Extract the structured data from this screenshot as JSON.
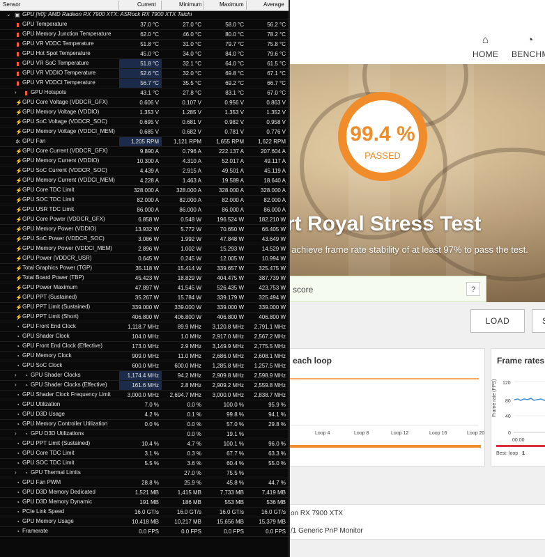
{
  "app": {
    "nav": {
      "home": "HOME",
      "benchmarks": "BENCHM"
    },
    "score": {
      "value": "99.4 %",
      "status": "PASSED"
    },
    "test_title": "rt Royal Stress Test",
    "test_subtitle": "t achieve frame rate stability of at least 97% to pass the test.",
    "score_box_label": "score",
    "help_label": "?",
    "load_label": "LOAD",
    "save_label": "S",
    "loop_panel_title": "each loop",
    "fps_panel_title": "Frame rates f",
    "loop_ticks": [
      "Loop 4",
      "Loop 8",
      "Loop 12",
      "Loop 16",
      "Loop 20"
    ],
    "fps_axis_label": "Frame rate (FPS)",
    "fps_ticks": [
      "120",
      "80",
      "40",
      "0"
    ],
    "fps_time_ticks": [
      "00:00",
      "00"
    ],
    "best_loop_label": "Best: loop",
    "best_loop_value": "1",
    "info_gpu": "on RX 7900 XTX",
    "info_monitor": "/1 Generic PnP Monitor",
    "colors": {
      "accent": "#f08d2a",
      "fps_line": "#3a8fd6"
    }
  },
  "hwinfo": {
    "columns": [
      "Sensor",
      "Current",
      "Minimum",
      "Maximum",
      "Average"
    ],
    "group_title": "GPU [#0]: AMD Radeon RX 7900 XTX: ASRock RX 7900 XTX Taichi",
    "rows": [
      {
        "icon": "temp",
        "name": "GPU Temperature",
        "cur": "37.0 °C",
        "min": "27.0 °C",
        "max": "58.0 °C",
        "avg": "56.2 °C"
      },
      {
        "icon": "temp",
        "name": "GPU Memory Junction Temperature",
        "cur": "62.0 °C",
        "min": "46.0 °C",
        "max": "80.0 °C",
        "avg": "78.2 °C"
      },
      {
        "icon": "temp",
        "name": "GPU VR VDDC Temperature",
        "cur": "51.8 °C",
        "min": "31.0 °C",
        "max": "79.7 °C",
        "avg": "75.8 °C"
      },
      {
        "icon": "temp",
        "name": "GPU Hot Spot Temperature",
        "cur": "45.0 °C",
        "min": "34.0 °C",
        "max": "84.0 °C",
        "avg": "79.6 °C"
      },
      {
        "icon": "temp",
        "name": "GPU VR SoC Temperature",
        "cur": "51.8 °C",
        "min": "32.1 °C",
        "max": "64.0 °C",
        "avg": "61.5 °C",
        "hl": true
      },
      {
        "icon": "temp",
        "name": "GPU VR VDDIO Temperature",
        "cur": "52.6 °C",
        "min": "32.0 °C",
        "max": "69.8 °C",
        "avg": "67.1 °C",
        "hl": true
      },
      {
        "icon": "temp",
        "name": "GPU VR VDDCI Temperature",
        "cur": "56.7 °C",
        "min": "35.5 °C",
        "max": "69.2 °C",
        "avg": "66.7 °C",
        "hl": true
      },
      {
        "icon": "temp",
        "name": "GPU Hotspots",
        "cur": "43.1 °C",
        "min": "27.8 °C",
        "max": "83.1 °C",
        "avg": "67.0 °C",
        "expand": true
      },
      {
        "icon": "volt",
        "name": "GPU Core Voltage (VDDCR_GFX)",
        "cur": "0.606 V",
        "min": "0.107 V",
        "max": "0.956 V",
        "avg": "0.863 V"
      },
      {
        "icon": "volt",
        "name": "GPU Memory Voltage (VDDIO)",
        "cur": "1.353 V",
        "min": "1.285 V",
        "max": "1.353 V",
        "avg": "1.352 V"
      },
      {
        "icon": "volt",
        "name": "GPU SoC Voltage (VDDCR_SOC)",
        "cur": "0.695 V",
        "min": "0.681 V",
        "max": "0.982 V",
        "avg": "0.958 V"
      },
      {
        "icon": "volt",
        "name": "GPU Memory Voltage (VDDCI_MEM)",
        "cur": "0.685 V",
        "min": "0.682 V",
        "max": "0.781 V",
        "avg": "0.776 V"
      },
      {
        "icon": "fan",
        "name": "GPU Fan",
        "cur": "1,205 RPM",
        "min": "1,121 RPM",
        "max": "1,655 RPM",
        "avg": "1,622 RPM",
        "hl": true
      },
      {
        "icon": "volt",
        "name": "GPU Core Current (VDDCR_GFX)",
        "cur": "9.890 A",
        "min": "0.796 A",
        "max": "222.137 A",
        "avg": "207.604 A"
      },
      {
        "icon": "volt",
        "name": "GPU Memory Current (VDDIO)",
        "cur": "10.300 A",
        "min": "4.310 A",
        "max": "52.017 A",
        "avg": "49.117 A"
      },
      {
        "icon": "volt",
        "name": "GPU SoC Current (VDDCR_SOC)",
        "cur": "4.439 A",
        "min": "2.915 A",
        "max": "49.501 A",
        "avg": "45.119 A"
      },
      {
        "icon": "volt",
        "name": "GPU Memory Current (VDDCI_MEM)",
        "cur": "4.228 A",
        "min": "1.463 A",
        "max": "19.589 A",
        "avg": "18.640 A"
      },
      {
        "icon": "volt",
        "name": "GPU Core TDC Limit",
        "cur": "328.000 A",
        "min": "328.000 A",
        "max": "328.000 A",
        "avg": "328.000 A"
      },
      {
        "icon": "volt",
        "name": "GPU SOC TDC Limit",
        "cur": "82.000 A",
        "min": "82.000 A",
        "max": "82.000 A",
        "avg": "82.000 A"
      },
      {
        "icon": "volt",
        "name": "GPU USR TDC Limit",
        "cur": "86.000 A",
        "min": "86.000 A",
        "max": "86.000 A",
        "avg": "86.000 A"
      },
      {
        "icon": "volt",
        "name": "GPU Core Power (VDDCR_GFX)",
        "cur": "6.858 W",
        "min": "0.548 W",
        "max": "196.524 W",
        "avg": "182.210 W"
      },
      {
        "icon": "volt",
        "name": "GPU Memory Power (VDDIO)",
        "cur": "13.932 W",
        "min": "5.772 W",
        "max": "70.650 W",
        "avg": "66.405 W"
      },
      {
        "icon": "volt",
        "name": "GPU SoC Power (VDDCR_SOC)",
        "cur": "3.086 W",
        "min": "1.992 W",
        "max": "47.848 W",
        "avg": "43.649 W"
      },
      {
        "icon": "volt",
        "name": "GPU Memory Power (VDDCI_MEM)",
        "cur": "2.896 W",
        "min": "1.002 W",
        "max": "15.293 W",
        "avg": "14.529 W"
      },
      {
        "icon": "volt",
        "name": "GPU Power (VDDCR_USR)",
        "cur": "0.645 W",
        "min": "0.245 W",
        "max": "12.005 W",
        "avg": "10.994 W"
      },
      {
        "icon": "volt",
        "name": "Total Graphics Power (TGP)",
        "cur": "35.118 W",
        "min": "15.414 W",
        "max": "339.657 W",
        "avg": "325.475 W"
      },
      {
        "icon": "volt",
        "name": "Total Board Power (TBP)",
        "cur": "45.423 W",
        "min": "18.829 W",
        "max": "404.475 W",
        "avg": "387.739 W"
      },
      {
        "icon": "volt",
        "name": "GPU Power Maximum",
        "cur": "47.897 W",
        "min": "41.545 W",
        "max": "526.435 W",
        "avg": "423.753 W"
      },
      {
        "icon": "volt",
        "name": "GPU PPT (Sustained)",
        "cur": "35.267 W",
        "min": "15.784 W",
        "max": "339.179 W",
        "avg": "325.494 W"
      },
      {
        "icon": "volt",
        "name": "GPU PPT Limit (Sustained)",
        "cur": "339.000 W",
        "min": "339.000 W",
        "max": "339.000 W",
        "avg": "339.000 W"
      },
      {
        "icon": "volt",
        "name": "GPU PPT Limit (Short)",
        "cur": "406.800 W",
        "min": "406.800 W",
        "max": "406.800 W",
        "avg": "406.800 W"
      },
      {
        "icon": "clk",
        "name": "GPU Front End Clock",
        "cur": "1,118.7 MHz",
        "min": "89.9 MHz",
        "max": "3,120.8 MHz",
        "avg": "2,791.1 MHz"
      },
      {
        "icon": "clk",
        "name": "GPU Shader Clock",
        "cur": "104.0 MHz",
        "min": "1.0 MHz",
        "max": "2,917.0 MHz",
        "avg": "2,567.2 MHz"
      },
      {
        "icon": "clk",
        "name": "GPU Front End Clock (Effective)",
        "cur": "173.0 MHz",
        "min": "2.9 MHz",
        "max": "3,149.9 MHz",
        "avg": "2,775.5 MHz"
      },
      {
        "icon": "clk",
        "name": "GPU Memory Clock",
        "cur": "909.0 MHz",
        "min": "11.0 MHz",
        "max": "2,686.0 MHz",
        "avg": "2,608.1 MHz"
      },
      {
        "icon": "clk",
        "name": "GPU SoC Clock",
        "cur": "600.0 MHz",
        "min": "600.0 MHz",
        "max": "1,285.8 MHz",
        "avg": "1,257.5 MHz"
      },
      {
        "icon": "clk",
        "name": "GPU Shader Clocks",
        "cur": "1,174.4 MHz",
        "min": "94.2 MHz",
        "max": "2,909.8 MHz",
        "avg": "2,598.9 MHz",
        "expand": true,
        "hl": true
      },
      {
        "icon": "clk",
        "name": "GPU Shader Clocks (Effective)",
        "cur": "161.6 MHz",
        "min": "2.8 MHz",
        "max": "2,909.2 MHz",
        "avg": "2,559.8 MHz",
        "expand": true,
        "hl": true
      },
      {
        "icon": "clk",
        "name": "GPU Shader Clock Frequency Limit",
        "cur": "3,000.0 MHz",
        "min": "2,694.7 MHz",
        "max": "3,000.0 MHz",
        "avg": "2,838.7 MHz"
      },
      {
        "icon": "pct",
        "name": "GPU Utilization",
        "cur": "7.0 %",
        "min": "0.0 %",
        "max": "100.0 %",
        "avg": "95.9 %"
      },
      {
        "icon": "pct",
        "name": "GPU D3D Usage",
        "cur": "4.2 %",
        "min": "0.1 %",
        "max": "99.8 %",
        "avg": "94.1 %"
      },
      {
        "icon": "pct",
        "name": "GPU Memory Controller Utilization",
        "cur": "0.0 %",
        "min": "0.0 %",
        "max": "57.0 %",
        "avg": "29.8 %"
      },
      {
        "icon": "pct",
        "name": "GPU D3D Utilizations",
        "cur": "",
        "min": "0.0 %",
        "max": "19.1 %",
        "avg": "",
        "expand": true
      },
      {
        "icon": "pct",
        "name": "GPU PPT Limit (Sustained)",
        "cur": "10.4 %",
        "min": "4.7 %",
        "max": "100.1 %",
        "avg": "96.0 %"
      },
      {
        "icon": "pct",
        "name": "GPU Core TDC Limit",
        "cur": "3.1 %",
        "min": "0.3 %",
        "max": "67.7 %",
        "avg": "63.3 %"
      },
      {
        "icon": "pct",
        "name": "GPU SOC TDC Limit",
        "cur": "5.5 %",
        "min": "3.6 %",
        "max": "60.4 %",
        "avg": "55.0 %"
      },
      {
        "icon": "pct",
        "name": "GPU Thermal Limits",
        "cur": "",
        "min": "27.0 %",
        "max": "75.5 %",
        "avg": "",
        "expand": true
      },
      {
        "icon": "pct",
        "name": "GPU Fan PWM",
        "cur": "28.8 %",
        "min": "25.9 %",
        "max": "45.8 %",
        "avg": "44.7 %"
      },
      {
        "icon": "dat",
        "name": "GPU D3D Memory Dedicated",
        "cur": "1,521 MB",
        "min": "1,415 MB",
        "max": "7,733 MB",
        "avg": "7,419 MB"
      },
      {
        "icon": "dat",
        "name": "GPU D3D Memory Dynamic",
        "cur": "191 MB",
        "min": "186 MB",
        "max": "553 MB",
        "avg": "536 MB"
      },
      {
        "icon": "dat",
        "name": "PCIe Link Speed",
        "cur": "16.0 GT/s",
        "min": "16.0 GT/s",
        "max": "16.0 GT/s",
        "avg": "16.0 GT/s"
      },
      {
        "icon": "dat",
        "name": "GPU Memory Usage",
        "cur": "10,418 MB",
        "min": "10,217 MB",
        "max": "15,656 MB",
        "avg": "15,379 MB"
      },
      {
        "icon": "dat",
        "name": "Framerate",
        "cur": "0.0 FPS",
        "min": "0.0 FPS",
        "max": "0.0 FPS",
        "avg": "0.0 FPS"
      }
    ]
  }
}
